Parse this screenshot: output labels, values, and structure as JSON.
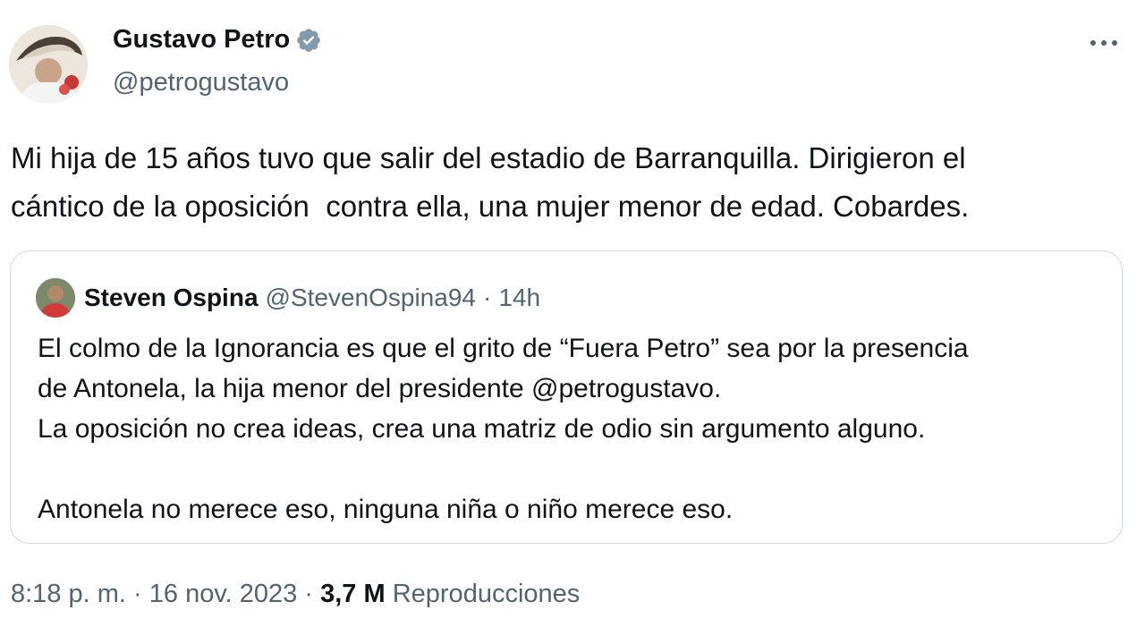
{
  "author": {
    "name": "Gustavo Petro",
    "handle": "@petrogustavo",
    "avatar_icon": "profile-photo",
    "verified_icon": "verified-badge-icon",
    "verified_color": "#829aab"
  },
  "tweet": {
    "text": "Mi hija de 15 años tuvo que salir del estadio de Barranquilla. Dirigieron el\ncántico de la oposición  contra ella, una mujer menor de edad. Cobardes."
  },
  "quoted_tweet": {
    "name": "Steven Ospina",
    "handle": "@StevenOspina94",
    "separator": "·",
    "time": "14h",
    "text": "El colmo de la Ignorancia es que el grito de “Fuera Petro” sea por la presencia\nde Antonela, la hija menor del presidente @petrogustavo.\nLa oposición no crea ideas, crea una matriz de odio sin argumento alguno.\n\nAntonela no merece eso, ninguna niña o niño merece eso."
  },
  "footer": {
    "time": "8:18 p. m.",
    "date": "16 nov. 2023",
    "separator": "·",
    "views_count": "3,7 M",
    "views_label": "Reproducciones"
  },
  "colors": {
    "text": "#0f1419",
    "secondary": "#536471",
    "border": "#cfd9de"
  }
}
